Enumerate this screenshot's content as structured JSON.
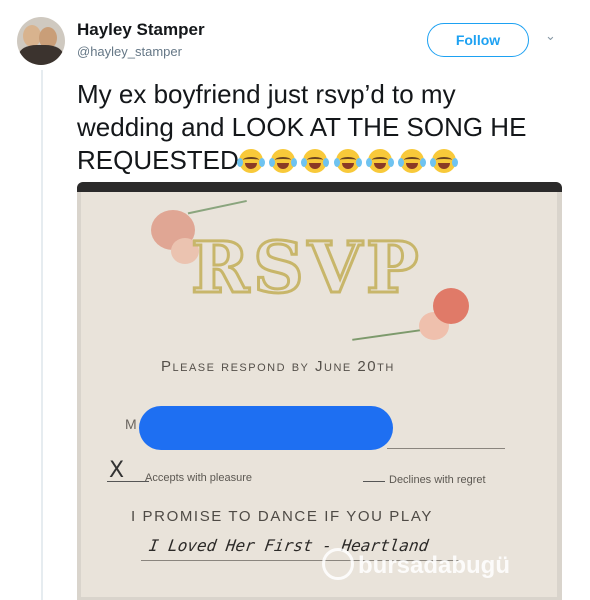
{
  "author": {
    "name": "Hayley Stamper",
    "handle": "@hayley_stamper"
  },
  "follow_label": "Follow",
  "more_icon": "chevron-down-icon",
  "tweet": {
    "text": "My ex boyfriend just rsvp’d to my wedding and LOOK AT THE SONG HE REQUESTED",
    "emoji_count": 7,
    "emoji_name": "face-with-tears-of-joy"
  },
  "card": {
    "heading": "RSVP",
    "respond_by": "Please respond by June 20th",
    "mr_prefix": "M",
    "x_mark": "X",
    "accepts": "Accepts with pleasure",
    "declines": "Declines with regret",
    "promise": "I PROMISE TO DANCE IF YOU PLAY",
    "song": "I Loved Her First - Heartland"
  },
  "watermark": "bursadabugü",
  "colors": {
    "accent": "#1da1f2",
    "redaction": "#1e6ff2",
    "rsvp_gold": "#c8b66a"
  }
}
